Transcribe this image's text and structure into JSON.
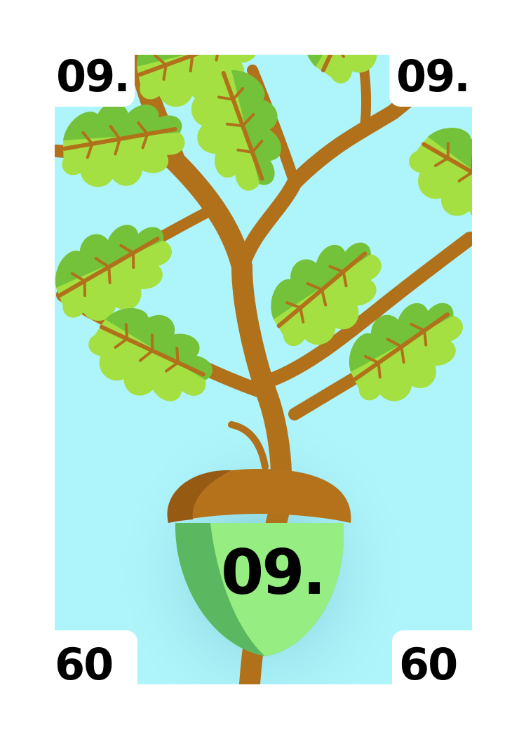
{
  "card": {
    "rank_label": "09.",
    "rotated_label": "60",
    "center_label": "09.",
    "colors": {
      "sky": "#aef4fb",
      "leaf_dark": "#74c13a",
      "leaf_light": "#a4e041",
      "branch": "#b1701a",
      "acorn_cap": "#b4721a",
      "acorn_body_light": "#96ee82",
      "acorn_body_dark": "#5cb860"
    },
    "icons": [
      "oak-branch",
      "oak-leaf",
      "acorn"
    ]
  }
}
